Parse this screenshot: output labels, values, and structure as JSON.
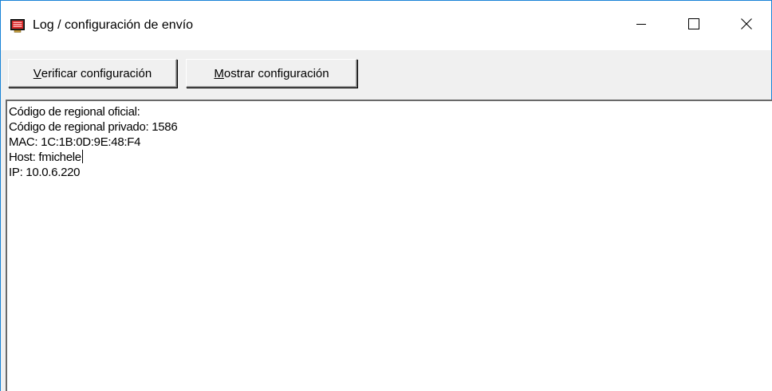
{
  "window": {
    "title": "Log / configuración de envío",
    "icon": "monitor-app-icon",
    "controls": {
      "minimize": "minimize-icon",
      "maximize": "maximize-icon",
      "close": "close-icon"
    }
  },
  "toolbar": {
    "verify_button": {
      "mnemonic": "V",
      "rest": "erificar configuración"
    },
    "show_button": {
      "mnemonic": "M",
      "rest": "ostrar configuración"
    }
  },
  "log": {
    "lines": [
      "Código de regional oficial:",
      "Código de regional privado: 1586",
      "MAC: 1C:1B:0D:9E:48:F4",
      "Host: fmichele",
      "IP: 10.0.6.220"
    ]
  },
  "colors": {
    "window_border": "#1883d7",
    "face": "#f0f0f0",
    "icon_red": "#d42020"
  }
}
